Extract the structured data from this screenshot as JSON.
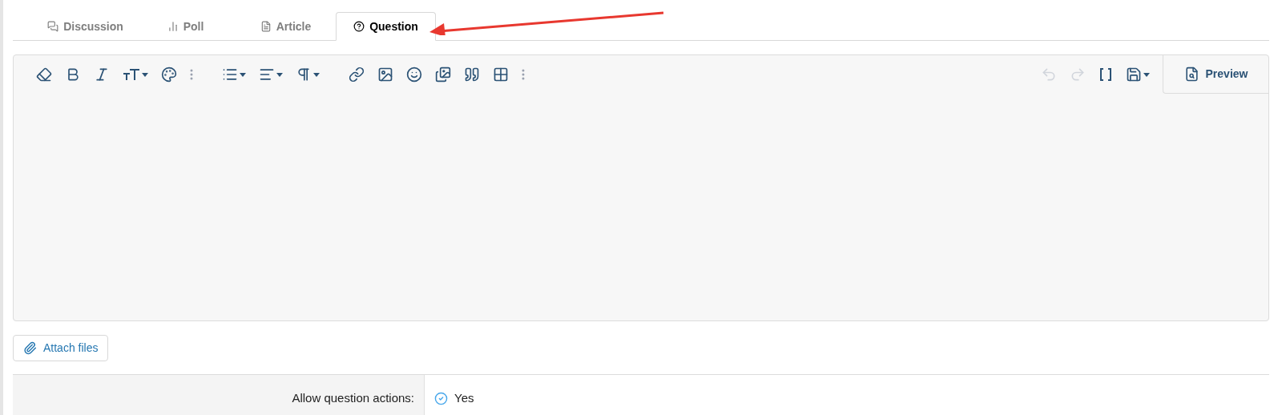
{
  "tabs": [
    {
      "label": "Discussion",
      "kind": "discussion",
      "selected": false
    },
    {
      "label": "Poll",
      "kind": "poll",
      "selected": false
    },
    {
      "label": "Article",
      "kind": "article",
      "selected": false
    },
    {
      "label": "Question",
      "kind": "question",
      "selected": true
    }
  ],
  "toolbar": [
    {
      "kind": "eraser",
      "disabled": false
    },
    {
      "kind": "bold",
      "disabled": false
    },
    {
      "kind": "italic",
      "disabled": false
    },
    {
      "kind": "size",
      "disabled": false
    },
    {
      "kind": "palette",
      "disabled": false
    },
    {
      "kind": "more",
      "disabled": false
    },
    {
      "kind": "gap"
    },
    {
      "kind": "list",
      "disabled": false
    },
    {
      "kind": "align",
      "disabled": false
    },
    {
      "kind": "paragraph",
      "disabled": false
    },
    {
      "kind": "gap"
    },
    {
      "kind": "link",
      "disabled": false
    },
    {
      "kind": "image",
      "disabled": false
    },
    {
      "kind": "smile",
      "disabled": false
    },
    {
      "kind": "gallery",
      "disabled": false
    },
    {
      "kind": "quote",
      "disabled": false
    },
    {
      "kind": "table",
      "disabled": false
    },
    {
      "kind": "more",
      "disabled": false
    }
  ],
  "toolbar_right": [
    {
      "kind": "undo",
      "disabled": true
    },
    {
      "kind": "redo",
      "disabled": true
    },
    {
      "kind": "brackets",
      "disabled": false
    },
    {
      "kind": "save",
      "disabled": false
    }
  ],
  "preview": {
    "label": "Preview"
  },
  "attach_button": {
    "label": "Attach files"
  },
  "field": {
    "label": "Allow question actions:",
    "value": "Yes",
    "checked": true
  }
}
